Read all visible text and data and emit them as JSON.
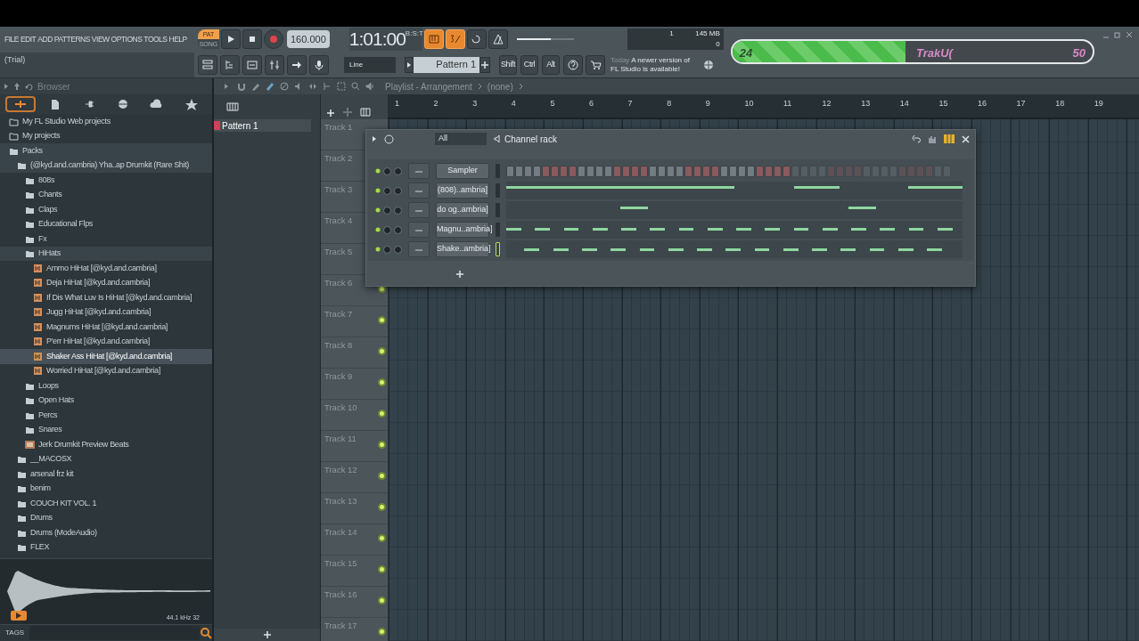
{
  "menu": [
    "FILE",
    "EDIT",
    "ADD",
    "PATTERNS",
    "VIEW",
    "OPTIONS",
    "TOOLS",
    "HELP"
  ],
  "transport": {
    "modes": [
      {
        "label": "PAT",
        "selected": true
      },
      {
        "label": "SONG",
        "selected": false
      }
    ],
    "tempo": "160.000",
    "time": "1:01:00",
    "time_unit": "B:S:T"
  },
  "mode_buttons": [
    {
      "kind": "keyboard",
      "on": true
    },
    {
      "kind": "countdown",
      "on": true
    },
    {
      "kind": "loop",
      "on": false
    },
    {
      "kind": "metronome",
      "on": false
    }
  ],
  "master_volume": {
    "level": 0.6
  },
  "cpu": {
    "voices": "1",
    "memory": "145 MB",
    "polyphony": "0"
  },
  "hint": "(Trial)",
  "snap": "Line",
  "pattern": "Pattern 1",
  "modifiers": [
    "Shift",
    "Ctrl",
    "Alt"
  ],
  "news": {
    "date": "Today",
    "message": "A newer version of FL Studio is available!"
  },
  "goal_bar": {
    "start": "24",
    "label": "TrakU(",
    "end": "50",
    "level": 0.48
  },
  "browser": {
    "title": "Browser",
    "tabs": [
      {
        "kind": "all",
        "selected": true
      },
      {
        "kind": "file",
        "selected": false
      },
      {
        "kind": "plugin",
        "selected": false
      },
      {
        "kind": "globe",
        "selected": false
      },
      {
        "kind": "cloud",
        "selected": false
      },
      {
        "kind": "star",
        "selected": false
      }
    ],
    "tree": [
      {
        "label": "My FL Studio Web projects",
        "kind": "link",
        "selected": false
      },
      {
        "label": "My projects",
        "kind": "link",
        "selected": false
      },
      {
        "label": "Packs",
        "kind": "folder",
        "selected": false,
        "expanded": true,
        "children": [
          {
            "label": "(@kyd.and.cambria) Yha..ap Drumkit (Rare Shit)",
            "kind": "folder",
            "selected": false,
            "expanded": true,
            "children": [
              {
                "label": "808s",
                "kind": "folder",
                "selected": false,
                "expanded": false
              },
              {
                "label": "Chants",
                "kind": "folder",
                "selected": false,
                "expanded": false
              },
              {
                "label": "Claps",
                "kind": "folder",
                "selected": false,
                "expanded": false
              },
              {
                "label": "Educational Flps",
                "kind": "folder",
                "selected": false,
                "expanded": false
              },
              {
                "label": "Fx",
                "kind": "folder",
                "selected": false,
                "expanded": false
              },
              {
                "label": "HiHats",
                "kind": "folder",
                "selected": false,
                "expanded": true,
                "children": [
                  {
                    "label": "Ammo HiHat [@kyd.and.cambria]",
                    "kind": "audio",
                    "selected": false
                  },
                  {
                    "label": "Deja HiHat [@kyd.and.cambria]",
                    "kind": "audio",
                    "selected": false
                  },
                  {
                    "label": "If Dis What Luv Is HiHat [@kyd.and.cambria]",
                    "kind": "audio",
                    "selected": false
                  },
                  {
                    "label": "Jugg HiHat [@kyd.and.cambria]",
                    "kind": "audio",
                    "selected": false
                  },
                  {
                    "label": "Magnums HiHat [@kyd.and.cambria]",
                    "kind": "audio",
                    "selected": false
                  },
                  {
                    "label": "P'err HiHat [@kyd.and.cambria]",
                    "kind": "audio",
                    "selected": false
                  },
                  {
                    "label": "Shaker Ass HiHat [@kyd.and.cambria]",
                    "kind": "audio",
                    "selected": true
                  },
                  {
                    "label": "Worried HiHat [@kyd.and.cambria]",
                    "kind": "audio",
                    "selected": false
                  }
                ]
              },
              {
                "label": "Loops",
                "kind": "folder",
                "selected": false,
                "expanded": false
              },
              {
                "label": "Open Hats",
                "kind": "folder",
                "selected": false,
                "expanded": false
              },
              {
                "label": "Percs",
                "kind": "folder",
                "selected": false,
                "expanded": false
              },
              {
                "label": "Snares",
                "kind": "folder",
                "selected": false,
                "expanded": false
              },
              {
                "label": "Jerk Drumkit Preview Beats",
                "kind": "project",
                "selected": false
              }
            ]
          },
          {
            "label": "__MACOSX",
            "kind": "folder",
            "selected": false,
            "expanded": false
          },
          {
            "label": "arsenal frz kit",
            "kind": "folder",
            "selected": false,
            "expanded": false
          },
          {
            "label": "benim",
            "kind": "folder",
            "selected": false,
            "expanded": false
          },
          {
            "label": "COUCH KIT VOL. 1",
            "kind": "folder",
            "selected": false,
            "expanded": false
          },
          {
            "label": "Drums",
            "kind": "folder",
            "selected": false,
            "expanded": false
          },
          {
            "label": "Drums (ModeAudio)",
            "kind": "folder",
            "selected": false,
            "expanded": false
          },
          {
            "label": "FLEX",
            "kind": "folder",
            "selected": false,
            "expanded": false
          }
        ]
      }
    ],
    "preview": {
      "info": "44.1 kHz 32"
    },
    "tags_label": "TAGS"
  },
  "patterns": [
    {
      "label": "Pattern 1",
      "selected": true
    }
  ],
  "playlist": {
    "title": "Playlist - Arrangement",
    "breadcrumb": "(none)",
    "ruler": [
      "1",
      "2",
      "3",
      "4",
      "5",
      "6",
      "7",
      "8",
      "9",
      "10",
      "11",
      "12",
      "13",
      "14",
      "15",
      "16",
      "17",
      "18",
      "19"
    ],
    "tracks": [
      {
        "label": "Track 1"
      },
      {
        "label": "Track 2"
      },
      {
        "label": "Track 3"
      },
      {
        "label": "Track 4"
      },
      {
        "label": "Track 5"
      },
      {
        "label": "Track 6",
        "enabled": true
      },
      {
        "label": "Track 7",
        "enabled": true
      },
      {
        "label": "Track 8",
        "enabled": true
      },
      {
        "label": "Track 9",
        "enabled": true
      },
      {
        "label": "Track 10",
        "enabled": true
      },
      {
        "label": "Track 11",
        "enabled": true
      },
      {
        "label": "Track 12",
        "enabled": true
      },
      {
        "label": "Track 13",
        "enabled": true
      },
      {
        "label": "Track 14",
        "enabled": true
      },
      {
        "label": "Track 15",
        "enabled": true
      },
      {
        "label": "Track 16",
        "enabled": true
      },
      {
        "label": "Track 17",
        "enabled": true
      }
    ]
  },
  "channel_rack": {
    "filter": "All",
    "title": "Channel rack",
    "channels": [
      {
        "name": "Sampler",
        "kind": "steps",
        "selected": false
      },
      {
        "name": "(808)..ambria]",
        "kind": "notes",
        "selected": false
      },
      {
        "name": "do og..ambria]",
        "kind": "notes",
        "selected": false
      },
      {
        "name": "Magnu..ambria]",
        "kind": "notes",
        "selected": false
      },
      {
        "name": "Shake..ambria]",
        "kind": "notes",
        "selected": true
      }
    ]
  }
}
